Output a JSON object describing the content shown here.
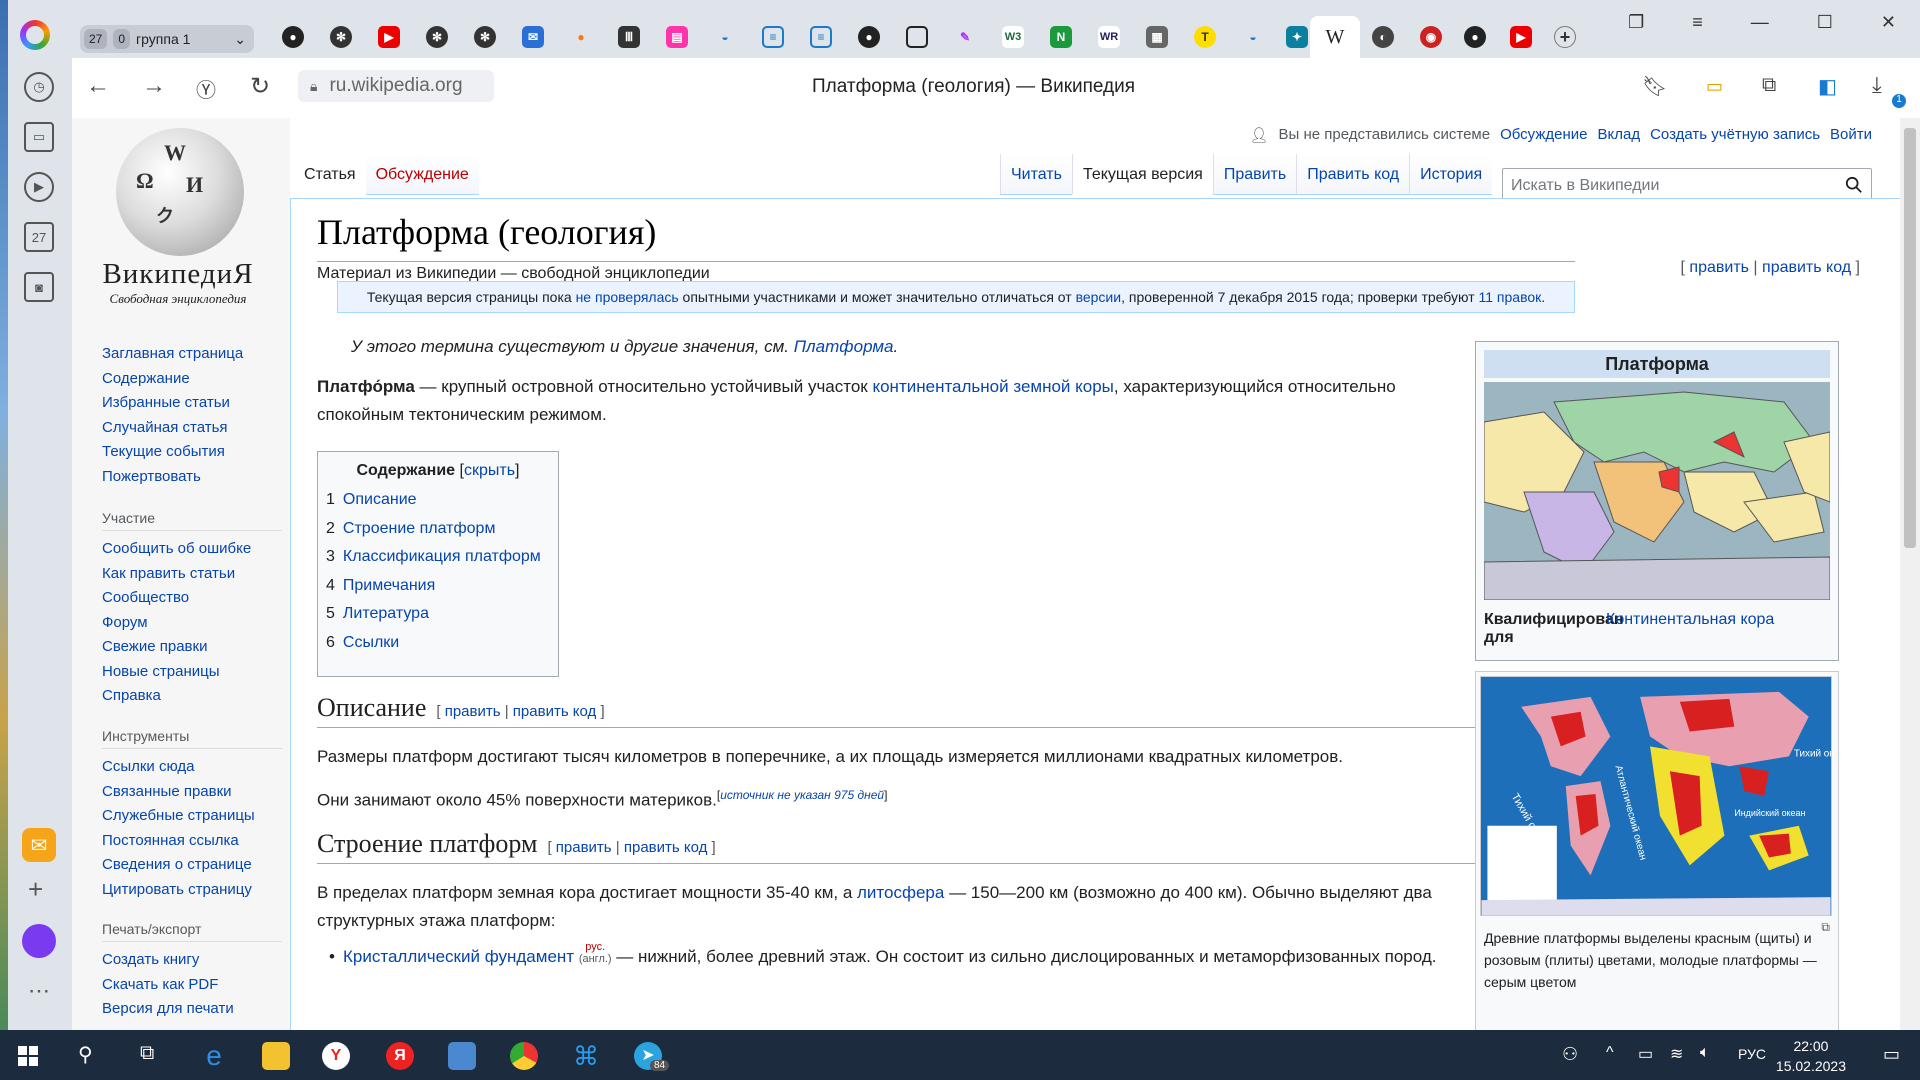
{
  "browser": {
    "group_count": "27",
    "group_badge": "0",
    "group_label": "группа 1",
    "active_tab_glyph": "W",
    "url": "ru.wikipedia.org",
    "page_title": "Платформа (геология) — Википедия",
    "downloads_badge": "1",
    "sidebar_badge": "27"
  },
  "wiki": {
    "wordmark": "ВикипедиЯ",
    "tagline": "Свободная энциклопедия",
    "personal": {
      "anon": "Вы не представились системе",
      "talk": "Обсуждение",
      "contrib": "Вклад",
      "create": "Создать учётную запись",
      "login": "Войти"
    },
    "tabs_left": [
      "Статья",
      "Обсуждение"
    ],
    "tabs_right": [
      "Читать",
      "Текущая версия",
      "Править",
      "Править код",
      "История"
    ],
    "search_placeholder": "Искать в Википедии",
    "nav_main": [
      "Заглавная страница",
      "Содержание",
      "Избранные статьи",
      "Случайная статья",
      "Текущие события",
      "Пожертвовать"
    ],
    "participation": {
      "heading": "Участие",
      "items": [
        "Сообщить об ошибке",
        "Как править статьи",
        "Сообщество",
        "Форум",
        "Свежие правки",
        "Новые страницы",
        "Справка"
      ]
    },
    "tools": {
      "heading": "Инструменты",
      "items": [
        "Ссылки сюда",
        "Связанные правки",
        "Служебные страницы",
        "Постоянная ссылка",
        "Сведения о странице",
        "Цитировать страницу"
      ]
    },
    "print": {
      "heading": "Печать/экспорт",
      "items": [
        "Создать книгу",
        "Скачать как PDF",
        "Версия для печати"
      ]
    }
  },
  "article": {
    "title": "Платформа (геология)",
    "site_sub": "Материал из Википедии — свободной энциклопедии",
    "edit_top": {
      "open": "[ ",
      "edit": "править",
      "sep": " | ",
      "edit_code": "править код",
      "close": " ]"
    },
    "review": {
      "t1": "Текущая версия страницы пока ",
      "l1": "не проверялась",
      "t2": " опытными участниками и может значительно отличаться от ",
      "l2": "версии",
      "t3": ", проверенной 7 декабря 2015 года; проверки требуют ",
      "l3": "11 правок",
      "t4": "."
    },
    "hatnote": {
      "text": "У этого термина существуют и другие значения, см. ",
      "link": "Платформа",
      "end": "."
    },
    "lead": {
      "bold": "Платфо́рма",
      "t1": " — крупный островной относительно устойчивый участок ",
      "link": "континентальной земной коры",
      "t2": ", характеризующийся относительно спокойным тектоническим режимом."
    },
    "toc": {
      "title": "Содержание",
      "toggle": "скрыть",
      "items": [
        {
          "n": "1",
          "label": "Описание"
        },
        {
          "n": "2",
          "label": "Строение платформ"
        },
        {
          "n": "3",
          "label": "Классификация платформ"
        },
        {
          "n": "4",
          "label": "Примечания"
        },
        {
          "n": "5",
          "label": "Литература"
        },
        {
          "n": "6",
          "label": "Ссылки"
        }
      ]
    },
    "s1": {
      "heading": "Описание",
      "p1": "Размеры платформ достигают тысяч километров в поперечнике, а их площадь измеряется миллионами квадратных километров.",
      "p2": "Они занимают около 45% поверхности материков.",
      "cite": "источник не указан 975 дней"
    },
    "s2": {
      "heading": "Строение платформ",
      "p1a": "В пределах платформ земная кора достигает мощности 35-40 км, а ",
      "p1link": "литосфера",
      "p1b": " — 150—200 км (возможно до 400 км). Обычно выделяют два структурных этажа платформ:",
      "b1link": "Кристаллический фундамент",
      "b1rus": "рус.",
      "b1eng": "(англ.)",
      "b1text": " — нижний, более древний этаж. Он состоит из сильно дислоцированных и метаморфизованных пород."
    },
    "infobox": {
      "title": "Платформа",
      "label": "Квалифицирован для",
      "value": "Континентальная кора"
    },
    "thumb_caption": "Древние платформы выделены красным (щиты) и розовым (плиты) цветами, молодые платформы — серым цветом",
    "map_labels": [
      "Тихий океан",
      "Атлантический океан",
      "Тихий океан",
      "Индийский океан"
    ]
  },
  "section_edit": {
    "edit": "править",
    "edit_code": "править код"
  },
  "taskbar": {
    "lang": "РУС",
    "time": "22:00",
    "date": "15.02.2023",
    "telegram_badge": "84"
  }
}
